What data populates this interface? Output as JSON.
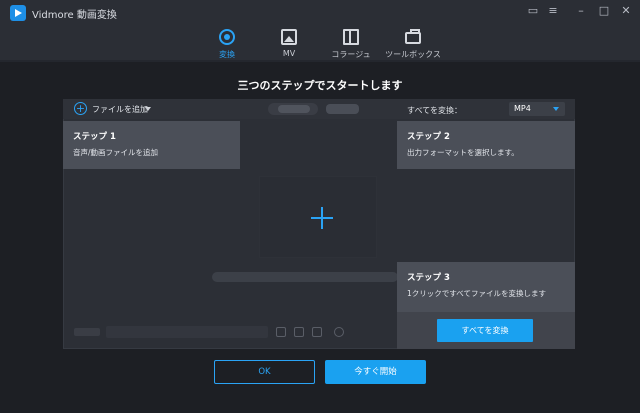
{
  "app": {
    "title": "Vidmore 動画変換"
  },
  "nav": {
    "tabs": [
      {
        "label": "変換",
        "icon": "convert-icon"
      },
      {
        "label": "MV",
        "icon": "mv-icon"
      },
      {
        "label": "コラージュ",
        "icon": "collage-icon"
      },
      {
        "label": "ツールボックス",
        "icon": "toolbox-icon"
      }
    ]
  },
  "heading": "三つのステップでスタートします",
  "toolbar": {
    "add_file_label": "ファイルを追加",
    "convert_all_label": "すべてを変換：",
    "format_value": "MP4"
  },
  "steps": [
    {
      "title": "ステップ 1",
      "desc": "音声/動画ファイルを追加"
    },
    {
      "title": "ステップ 2",
      "desc": "出力フォーマットを選択します。"
    },
    {
      "title": "ステップ 3",
      "desc": "1クリックですべてファイルを変換します"
    }
  ],
  "buttons": {
    "convert_all": "すべてを変換",
    "ok": "OK",
    "start_now": "今すぐ開始"
  },
  "colors": {
    "accent": "#1aa1f0",
    "background": "#1d1f24",
    "step_box": "#4b4f58"
  }
}
